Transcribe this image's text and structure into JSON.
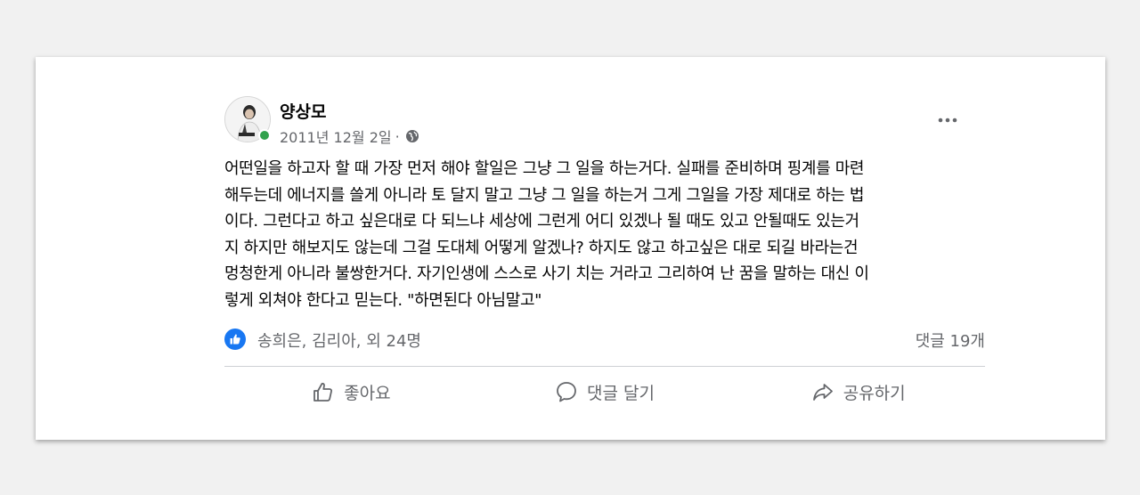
{
  "post": {
    "author": "양상모",
    "date": "2011년 12월 2일",
    "separator": "·",
    "audience_icon": "globe-icon",
    "body": "어떤일을 하고자 할 때 가장 먼저 해야 할일은 그냥 그 일을 하는거다. 실패를 준비하며 핑계를 마련\n해두는데 에너지를 쓸게 아니라 토 달지 말고 그냥 그 일을 하는거 그게 그일을 가장 제대로 하는 법\n이다. 그런다고 하고 싶은대로 다 되느냐 세상에 그런게 어디 있겠나 될 때도 있고 안될때도 있는거\n지 하지만 해보지도 않는데 그걸 도대체 어떻게 알겠나? 하지도 않고 하고싶은 대로 되길 바라는건\n멍청한게 아니라 불쌍한거다. 자기인생에 스스로 사기 치는 거라고 그리하여 난 꿈을 말하는 대신 이\n렇게 외쳐야 한다고 믿는다. \"하면된다 아님말고\"",
    "reactions": {
      "icon": "like-reaction-icon",
      "text": "송희은, 김리아, 외 24명",
      "color": "#1877f2"
    },
    "comments_count": "댓글 19개",
    "actions": {
      "like": "좋아요",
      "comment": "댓글 달기",
      "share": "공유하기"
    },
    "status_color": "#31a24c"
  }
}
